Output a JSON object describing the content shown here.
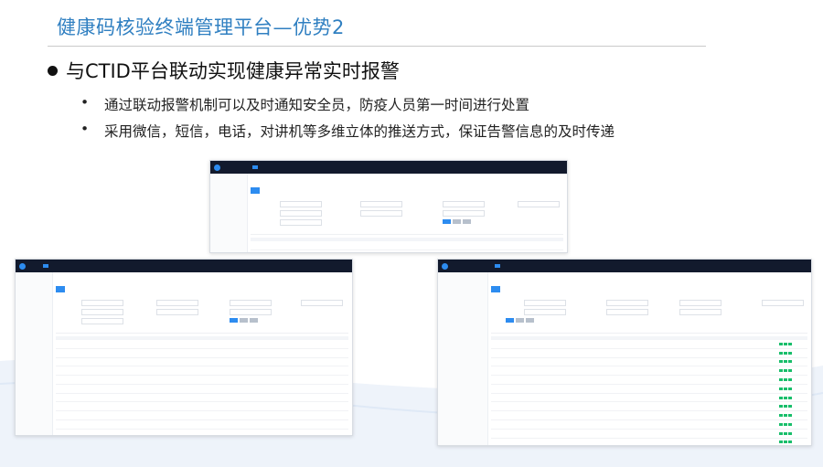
{
  "slide": {
    "title": "健康码核验终端管理平台—优势2",
    "heading": "与CTID平台联动实现健康异常实时报警",
    "bullets": [
      {
        "marker": "•",
        "text": "通过联动报警机制可以及时通知安全员，防疫人员第一时间进行处置"
      },
      {
        "marker": "•",
        "text": "采用微信，短信，电话，对讲机等多维立体的推送方式，保证告警信息的及时传递"
      }
    ]
  },
  "colors": {
    "title": "#2f7fc1",
    "topbar": "#121a2d",
    "accent": "#2d8cf0",
    "ok": "#19be6b"
  },
  "icons": {
    "bullet": "filled-circle"
  }
}
